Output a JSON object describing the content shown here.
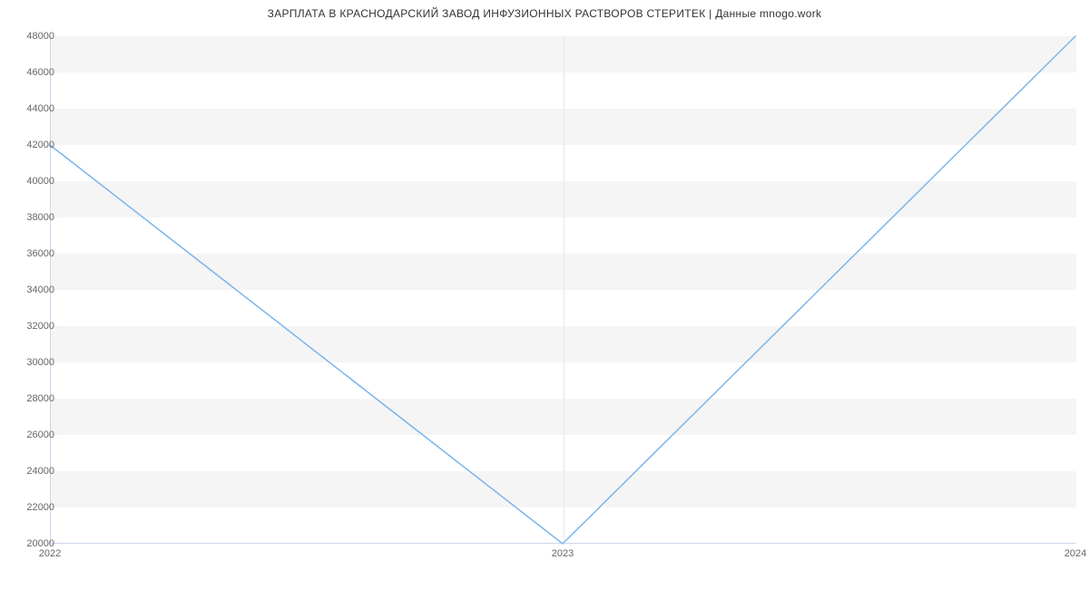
{
  "chart_data": {
    "type": "line",
    "title": "ЗАРПЛАТА В  КРАСНОДАРСКИЙ ЗАВОД ИНФУЗИОННЫХ РАСТВОРОВ СТЕРИТЕК | Данные mnogo.work",
    "x": [
      2022,
      2023,
      2024
    ],
    "values": [
      42000,
      20000,
      48000
    ],
    "x_ticks": [
      "2022",
      "2023",
      "2024"
    ],
    "y_ticks": [
      20000,
      22000,
      24000,
      26000,
      28000,
      30000,
      32000,
      34000,
      36000,
      38000,
      40000,
      42000,
      44000,
      46000,
      48000
    ],
    "ylim": [
      20000,
      48000
    ],
    "xlim": [
      2022,
      2024
    ],
    "xlabel": "",
    "ylabel": "",
    "line_color": "#7cb5ec"
  }
}
